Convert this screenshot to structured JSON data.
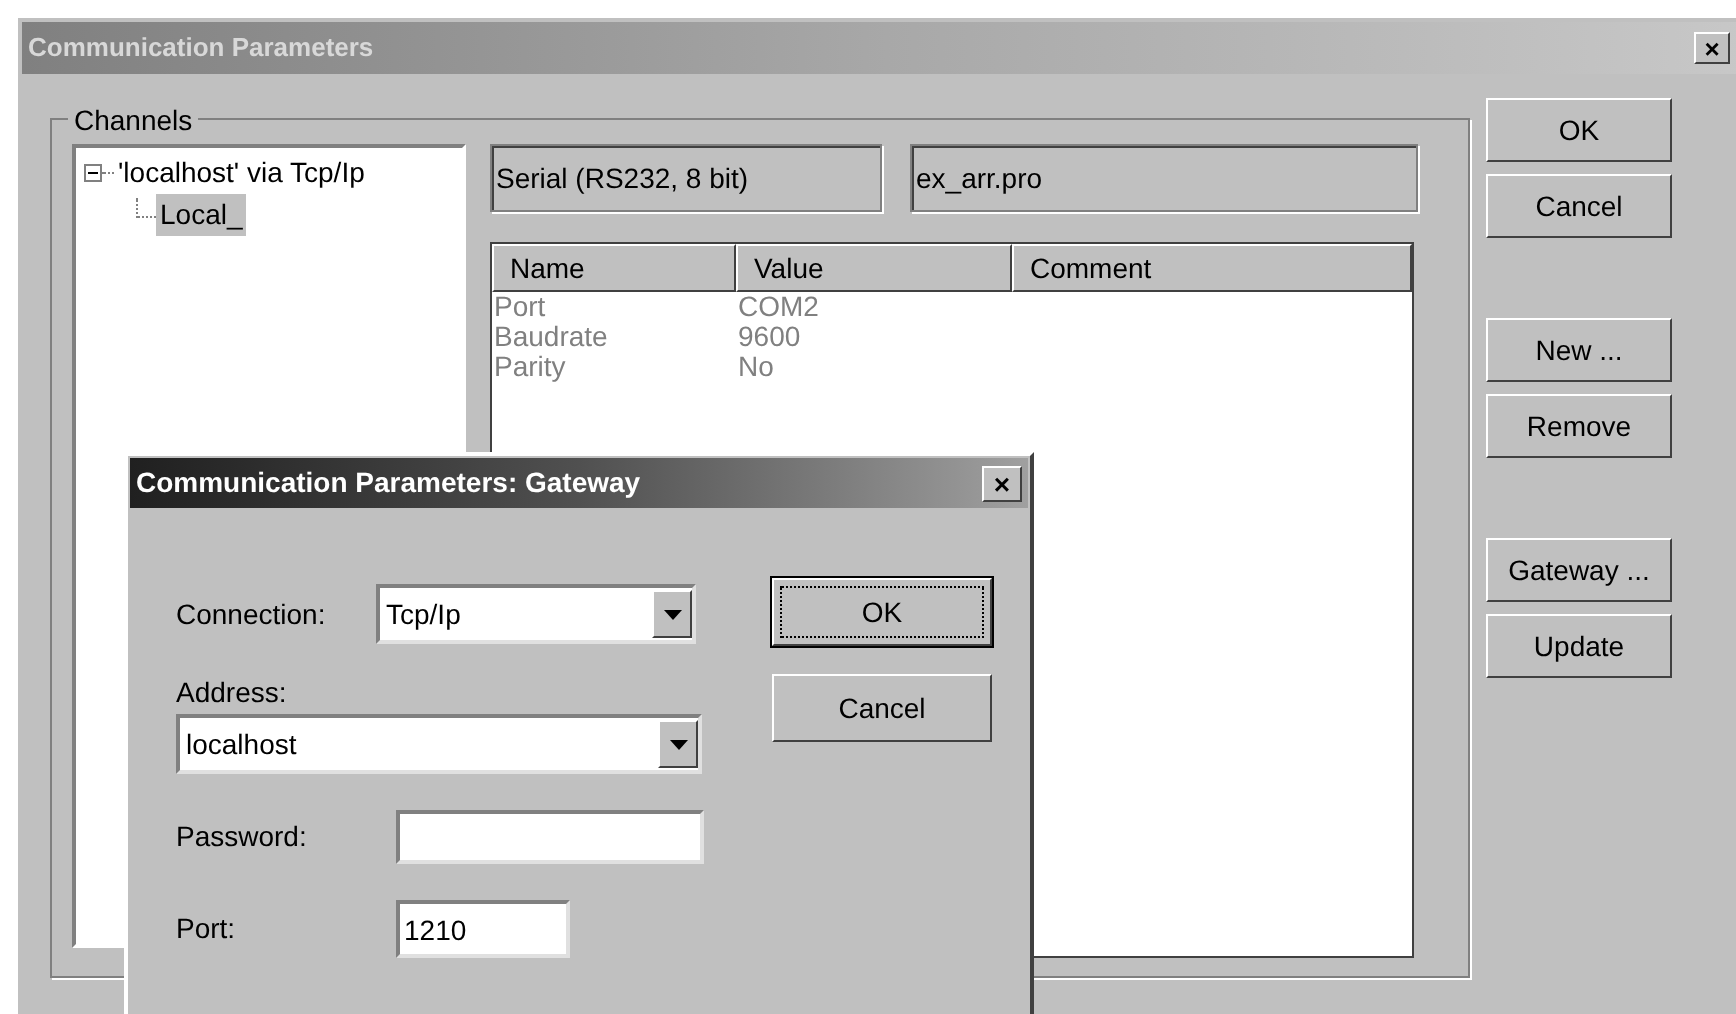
{
  "window": {
    "title": "Communication Parameters",
    "close": "×"
  },
  "channels": {
    "label": "Channels",
    "tree": [
      {
        "label": "'localhost' via Tcp/Ip",
        "expanded": true,
        "selected": false,
        "children": [
          {
            "label": "Local_",
            "selected": true
          }
        ]
      }
    ],
    "info": [
      "Serial (RS232, 8 bit)",
      "ex_arr.pro"
    ],
    "table": {
      "columns": [
        "Name",
        "Value",
        "Comment"
      ],
      "rows": [
        [
          "Port",
          "COM2",
          ""
        ],
        [
          "Baudrate",
          "9600",
          ""
        ],
        [
          "Parity",
          "No",
          ""
        ]
      ]
    }
  },
  "button_groups": [
    [
      "OK",
      "Cancel"
    ],
    [
      "New ...",
      "Remove"
    ],
    [
      "Gateway ...",
      "Update"
    ]
  ],
  "gateway": {
    "title": "Communication Parameters: Gateway",
    "close": "×",
    "connection": {
      "label": "Connection:",
      "value": "Tcp/Ip"
    },
    "address": {
      "label": "Address:",
      "value": "localhost"
    },
    "password": {
      "label": "Password:"
    },
    "port": {
      "label": "Port:",
      "value": "1210"
    },
    "buttons": [
      {
        "label": "OK",
        "default": true
      },
      {
        "label": "Cancel",
        "default": false
      }
    ]
  }
}
